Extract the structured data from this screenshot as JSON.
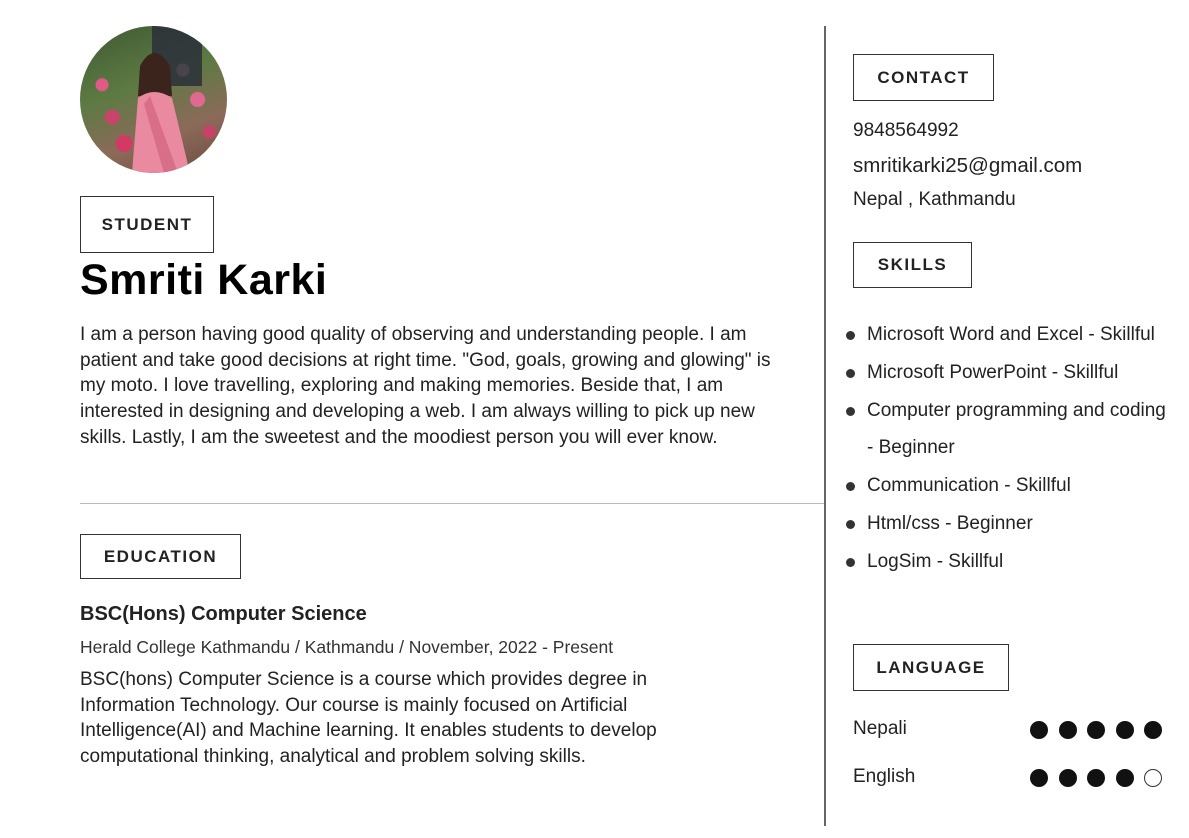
{
  "profile": {
    "role_tag": "STUDENT",
    "name": "Smriti Karki",
    "bio": "I am a person having good quality of observing and understanding people. I am patient and take good decisions at right time. \"God, goals, growing and glowing\" is my moto. I love travelling, exploring and making memories. Beside that, I am interested in designing and developing a web. I am always willing to pick up new skills. Lastly, I am the sweetest and the moodiest person you will ever know."
  },
  "education": {
    "heading": "EDUCATION",
    "degree": "BSC(Hons) Computer Science",
    "details": "Herald College Kathmandu / Kathmandu / November, 2022 - Present",
    "description": "BSC(hons) Computer Science is a course which provides degree in Information  Technology. Our course is mainly focused on Artificial Intelligence(AI) and Machine learning. It enables students to develop computational thinking, analytical and problem solving skills."
  },
  "contact": {
    "heading": "CONTACT",
    "phone": "9848564992",
    "email": "smritikarki25@gmail.com",
    "location": "Nepal ,  Kathmandu"
  },
  "skills": {
    "heading": "SKILLS",
    "items": [
      "Microsoft Word and Excel - Skillful",
      "Microsoft PowerPoint - Skillful",
      "Computer programming and coding - Beginner",
      "Communication - Skillful",
      "Html/css - Beginner",
      "LogSim - Skillful"
    ]
  },
  "language": {
    "heading": "LANGUAGE",
    "items": [
      {
        "name": "Nepali",
        "level": 5,
        "max": 5
      },
      {
        "name": "English",
        "level": 4,
        "max": 5
      }
    ]
  }
}
